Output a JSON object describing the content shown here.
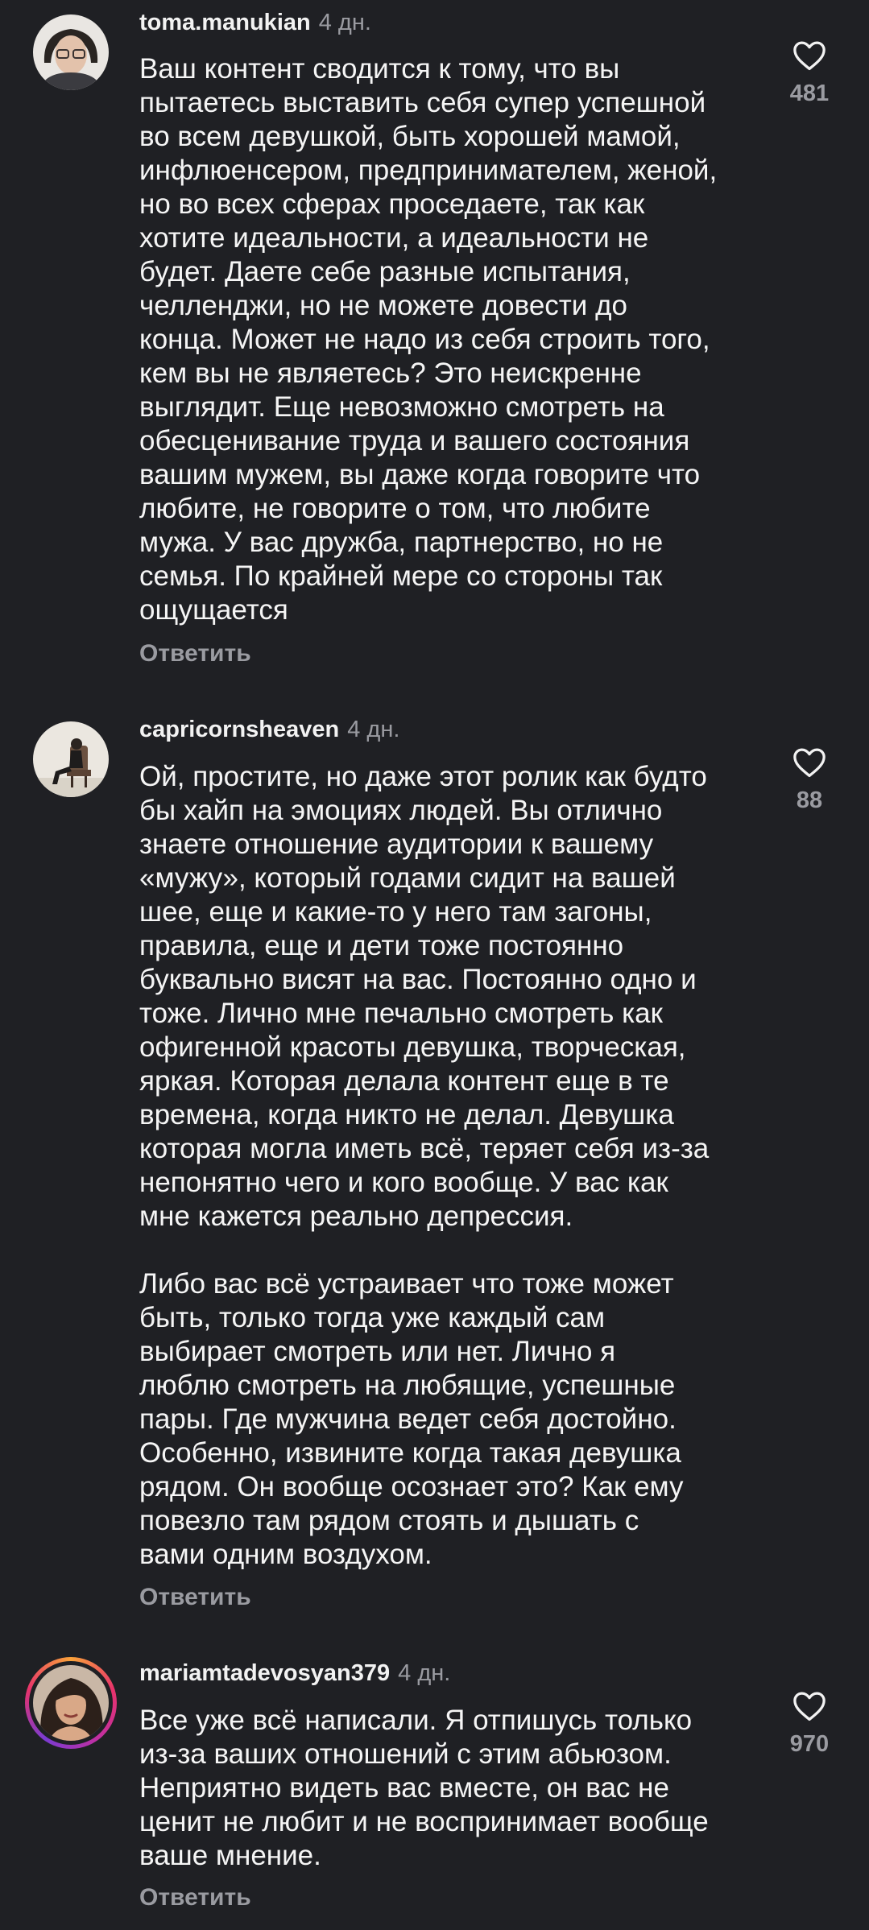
{
  "comments": [
    {
      "username": "toma.manukian",
      "time": "4 дн.",
      "text": "Ваш контент сводится к тому, что вы\nпытаетесь выставить себя супер успешной\nво всем девушкой, быть хорошей мамой,\nинфлюенсером, предпринимателем, женой,\nно во всех сферах проседаете, так как\nхотите идеальности, а идеальности не\nбудет. Даете себе разные испытания,\nчелленджи, но не можете довести до\nконца. Может не надо из себя строить того,\nкем вы не являетесь? Это неискренне\nвыглядит. Еще невозможно смотреть на\nобесценивание труда и вашего состояния\nвашим мужем, вы даже когда говорите что\nлюбите, не говорите о том, что любите\nмужа. У вас дружба, партнерство, но не\nсемья. По крайней мере со стороны так\nощущается",
      "reply_label": "Ответить",
      "likes": "481"
    },
    {
      "username": "capricornsheaven",
      "time": "4 дн.",
      "text": "Ой, простите, но даже этот ролик как будто\nбы хайп на эмоциях людей. Вы отлично\nзнаете отношение аудитории к вашему\n«мужу», который годами сидит на вашей\nшее, еще и какие-то у него там загоны,\nправила, еще и дети тоже постоянно\nбуквально висят на вас. Постоянно одно и\nтоже. Лично мне печально смотреть как\nофигенной красоты девушка, творческая,\nяркая. Которая делала контент еще в те\nвремена, когда никто не делал. Девушка\nкоторая могла иметь всё, теряет себя из-за\nнепонятно чего и кого вообще. У вас как\nмне кажется реально депрессия.\n\nЛибо вас всё устраивает что тоже может\nбыть, только тогда уже каждый сам\nвыбирает смотреть или нет. Лично я\nлюблю смотреть на любящие, успешные\nпары. Где мужчина ведет себя достойно.\nОсобенно, извините когда такая девушка\nрядом. Он вообще осознает это? Как ему\nповезло там рядом стоять и дышать с\nвами одним воздухом.",
      "reply_label": "Ответить",
      "likes": "88"
    },
    {
      "username": "mariamtadevosyan379",
      "time": "4 дн.",
      "text": "Все уже всё написали. Я отпишусь только\nиз-за ваших отношений с этим абьюзом.\nНеприятно видеть вас вместе, он вас не\nценит не любит и не воспринимает вообще\nваше мнение.",
      "reply_label": "Ответить",
      "likes": "970"
    }
  ],
  "colors": {
    "background": "#1f2024",
    "text": "#f5f5f5",
    "muted": "#9a9ba1"
  }
}
